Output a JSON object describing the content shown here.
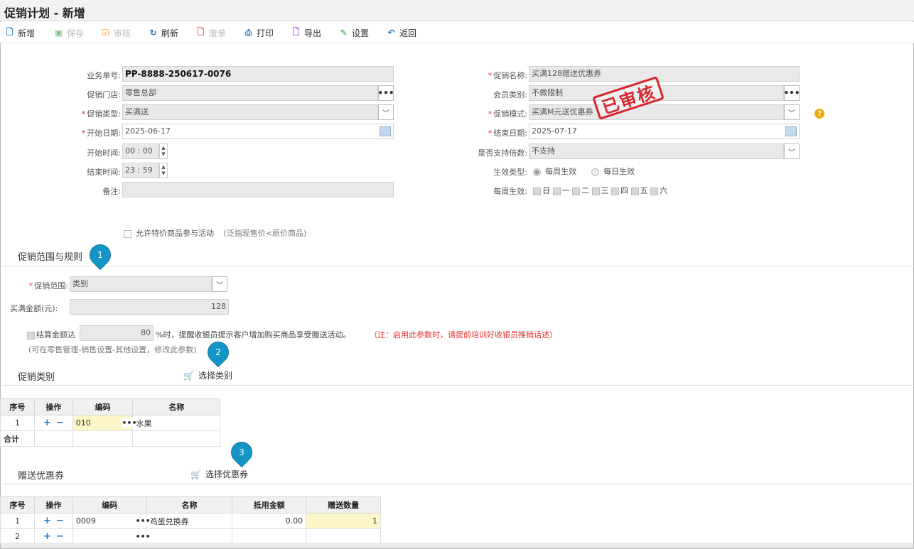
{
  "window": {
    "title": "促销计划 - 新增"
  },
  "toolbar": {
    "new": "新增",
    "save": "保存",
    "audit": "审核",
    "refresh": "刷新",
    "void": "废单",
    "print": "打印",
    "export": "导出",
    "settings": "设置",
    "back": "返回"
  },
  "form": {
    "doc_no_label": "业务单号:",
    "doc_no": "PP-8888-250617-0076",
    "store_label": "促销门店:",
    "store": "零售总部",
    "type_label": "促销类型:",
    "type": "买满送",
    "start_date_label": "开始日期:",
    "start_date": "2025-06-17",
    "start_time_label": "开始时间:",
    "start_hh": "00",
    "start_mm": "00",
    "end_time_label": "结束时间:",
    "end_hh": "23",
    "end_mm": "59",
    "remark_label": "备注:",
    "remark": "",
    "name_label": "促销名称:",
    "name": "买满128赠送优惠券",
    "member_label": "会员类别:",
    "member": "不做限制",
    "mode_label": "促销模式:",
    "mode": "买满M元送优惠券",
    "end_date_label": "结束日期:",
    "end_date": "2025-07-17",
    "multiple_label": "是否支持倍数:",
    "multiple": "不支持",
    "effect_label": "生效类型:",
    "effect_weekly": "每周生效",
    "effect_daily": "每日生效",
    "weekday_label": "每周生效:",
    "weekdays": [
      "日",
      "一",
      "二",
      "三",
      "四",
      "五",
      "六"
    ],
    "allow_special": "允许特价商品参与活动",
    "allow_special_note": "(泛指现售价<原价商品)",
    "stamp": "已审核",
    "time_sep": ":"
  },
  "rules": {
    "section_title": "促销范围与规则",
    "scope_label": "促销范围:",
    "scope": "类别",
    "amount_label": "买满金额(元):",
    "amount": "128",
    "checkout_label": "结算金额达",
    "checkout_pct": "80",
    "checkout_tail": "%时，提醒收银员提示客户增加购买商品享受赠送活动。",
    "checkout_note": "（注：启用此参数时，请提前培训好收银员推销话述）",
    "hint": "(可在零售管理-销售设置-其他设置，修改此参数)"
  },
  "category": {
    "section_title": "促销类别",
    "select_link": "选择类别",
    "headers": [
      "序号",
      "操作",
      "编码",
      "名称"
    ],
    "rows": [
      {
        "no": "1",
        "code": "010",
        "name": "水果"
      }
    ],
    "total_label": "合计"
  },
  "coupon": {
    "section_title": "赠送优惠券",
    "select_link": "选择优惠券",
    "headers": [
      "序号",
      "操作",
      "编码",
      "名称",
      "抵用金额",
      "赠送数量"
    ],
    "rows": [
      {
        "no": "1",
        "code": "0009",
        "name": "鸡蛋兑换券",
        "amount": "0.00",
        "qty": "1"
      },
      {
        "no": "2",
        "code": "",
        "name": "",
        "amount": "",
        "qty": ""
      }
    ]
  },
  "markers": [
    "1",
    "2",
    "3"
  ],
  "colors": {
    "accent": "#1a78c8",
    "required": "#e53333",
    "stamp": "#d9262e",
    "pin": "#1495c6",
    "highlight": "#fdf6c8"
  }
}
